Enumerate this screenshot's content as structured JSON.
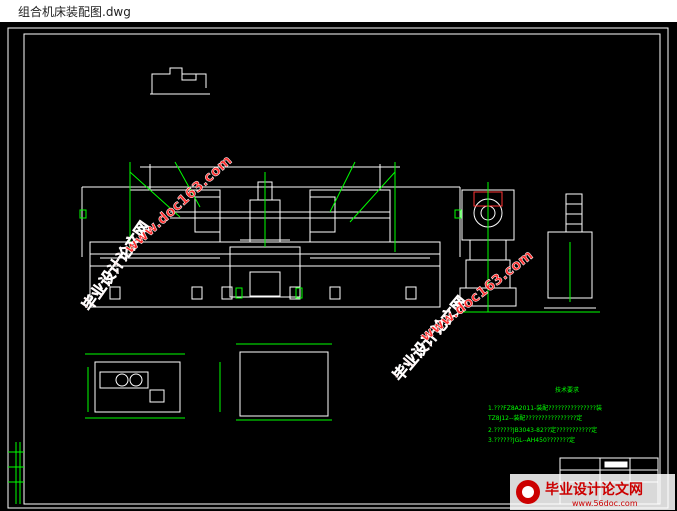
{
  "window": {
    "title": "组合机床装配图.dwg"
  },
  "drawing": {
    "background": "#000000",
    "line_color": "#ffffff",
    "accent_color": "#00ff00",
    "notes": {
      "heading": "技术要求",
      "lines": [
        "1.???FZ8A2011-装配???????????????装",
        "TZ8J12--装配????????????????定",
        "2.??????JB3043-82??定???????????定",
        "3.??????JGL--AH450???????定"
      ]
    }
  },
  "watermarks": {
    "brand_text": "毕业设计论文网",
    "url_text": "www.doc163.com",
    "corner_brand": "毕业设计论文网",
    "corner_url": "www.56doc.com"
  }
}
